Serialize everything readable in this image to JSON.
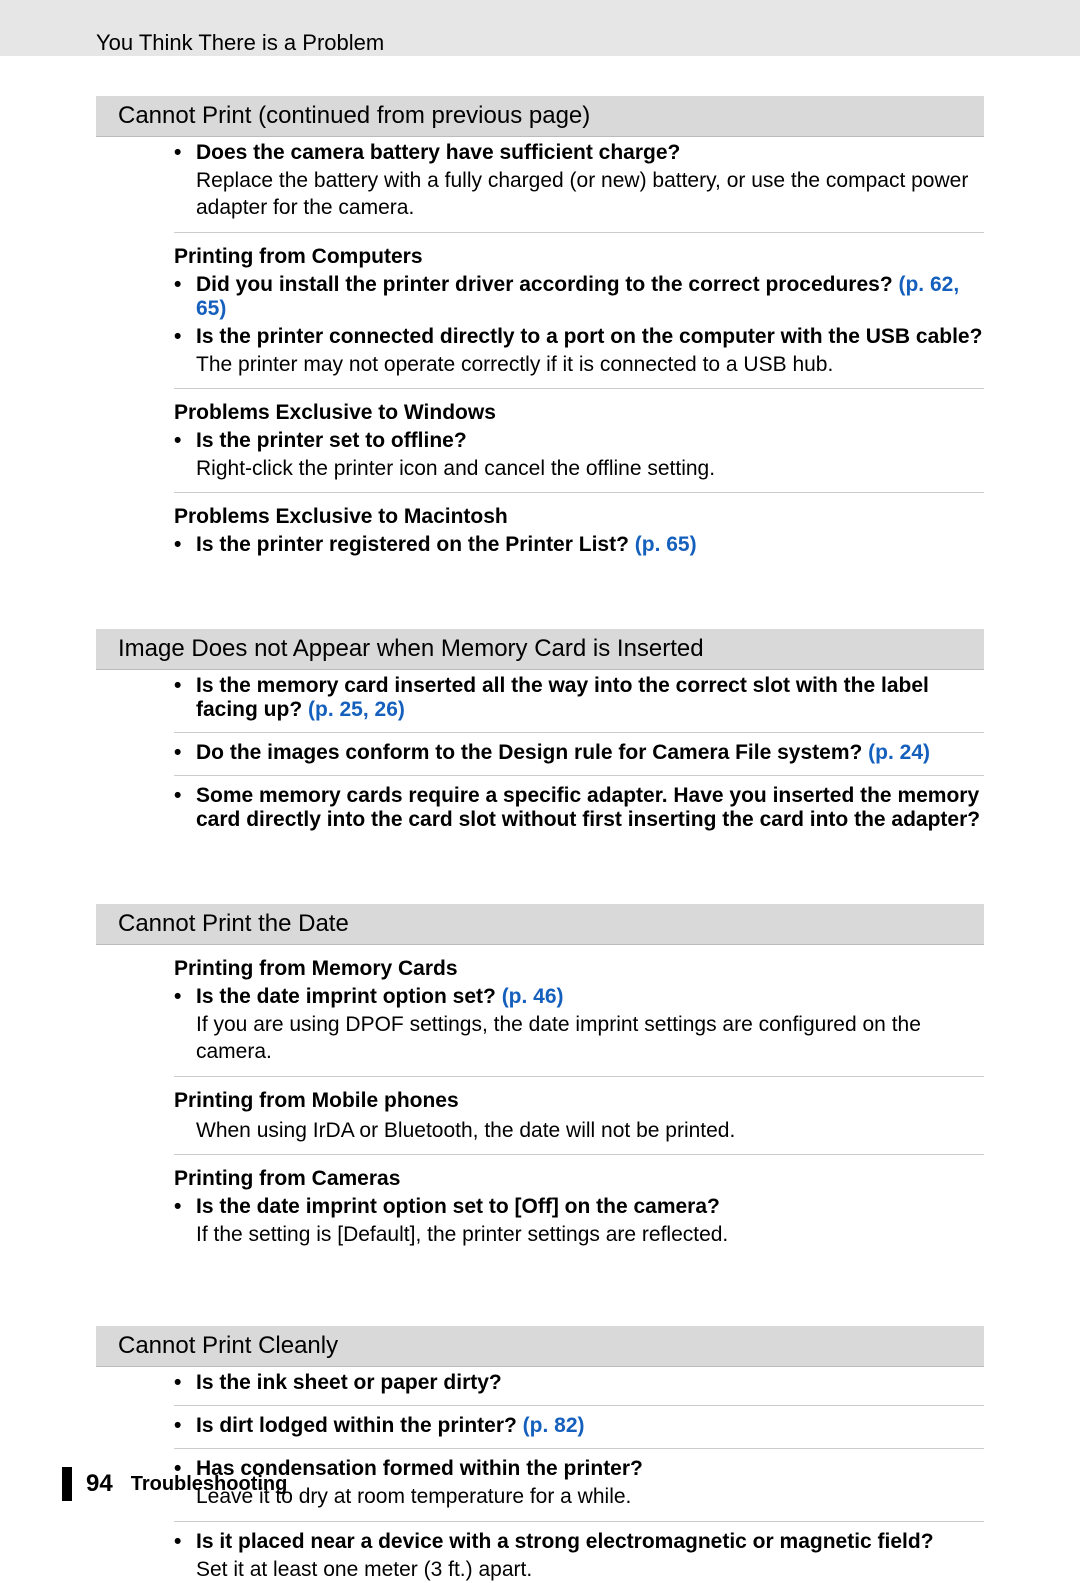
{
  "runningHead": "You Think There is a Problem",
  "sections": {
    "s1": {
      "title": "Cannot Print (continued from previous page)",
      "b1_q": "Does the camera battery have sufficient charge?",
      "b1_d": "Replace the battery with a fully charged (or new) battery, or use the compact power adapter for the camera.",
      "sub2": "Printing from Computers",
      "b2_q_pre": "Did you install the printer driver according to the correct procedures? ",
      "b2_ref1": "(p. 62",
      "b2_comma": ", ",
      "b2_ref2": "65)",
      "b3_q": "Is the printer connected directly to a port on the computer with the USB cable?",
      "b3_d": "The printer may not operate correctly if it is connected to a USB hub.",
      "sub3": "Problems Exclusive to Windows",
      "b4_q": "Is the printer set to offline?",
      "b4_d": "Right-click the printer icon and cancel the offline setting.",
      "sub4": "Problems Exclusive to Macintosh",
      "b5_q_pre": "Is the printer registered on the Printer List? ",
      "b5_ref": "(p. 65)"
    },
    "s2": {
      "title": "Image Does not Appear when Memory Card is Inserted",
      "b1_q_pre": "Is the memory card inserted all the way into the correct slot with the label facing up? ",
      "b1_ref1": "(p. 25",
      "b1_comma": ", ",
      "b1_ref2": "26)",
      "b2_q_pre": "Do the images conform to the Design rule for Camera File system? ",
      "b2_ref": "(p. 24)",
      "b3_q": "Some memory cards require a specific adapter. Have you inserted the memory card directly into the card slot without first inserting the card into the adapter?"
    },
    "s3": {
      "title": "Cannot Print the Date",
      "sub1": "Printing from Memory Cards",
      "b1_q_pre": "Is the date imprint option set? ",
      "b1_ref": "(p. 46)",
      "b1_d": "If you are using DPOF settings, the date imprint settings are configured on the camera.",
      "sub2": "Printing from Mobile phones",
      "b2_d": "When using IrDA or Bluetooth, the date will not be printed.",
      "sub3": "Printing from Cameras",
      "b3_q": "Is the date imprint option set to [Off] on the camera?",
      "b3_d": "If the setting is [Default], the printer settings are reflected."
    },
    "s4": {
      "title": "Cannot Print Cleanly",
      "b1_q": "Is the ink sheet or paper dirty?",
      "b2_q_pre": "Is dirt lodged within the printer? ",
      "b2_ref": "(p. 82)",
      "b3_q": "Has condensation formed within the printer?",
      "b3_d": "Leave it to dry at room temperature for a while.",
      "b4_q": "Is it placed near a device with a strong electromagnetic or magnetic field?",
      "b4_d": "Set it at least one meter (3 ft.) apart."
    }
  },
  "footer": {
    "page": "94",
    "label": "Troubleshooting"
  }
}
